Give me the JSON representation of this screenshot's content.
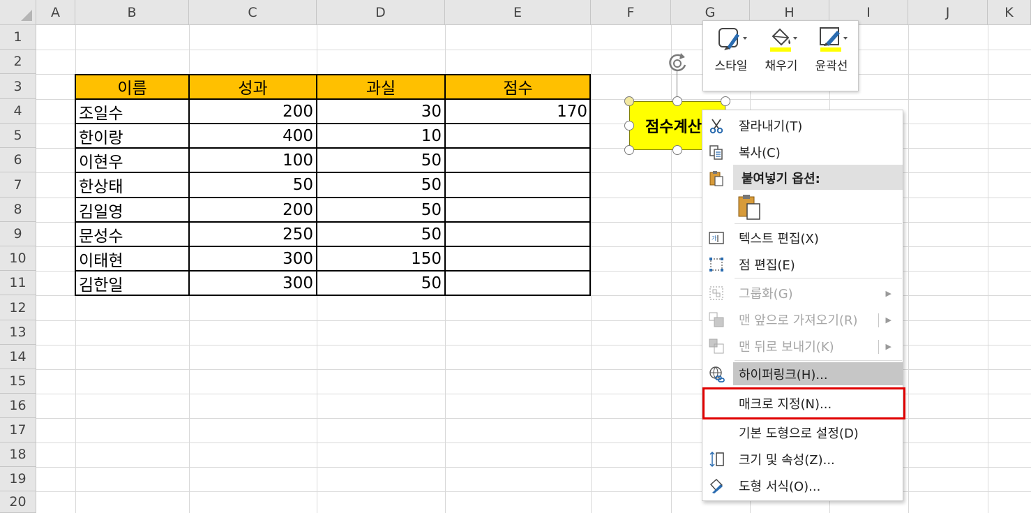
{
  "columns": [
    "A",
    "B",
    "C",
    "D",
    "E",
    "F",
    "G",
    "H",
    "I",
    "J",
    "K"
  ],
  "rows": [
    "1",
    "2",
    "3",
    "4",
    "5",
    "6",
    "7",
    "8",
    "9",
    "10",
    "11",
    "12",
    "13",
    "14",
    "15",
    "16",
    "17",
    "18",
    "19",
    "20"
  ],
  "table": {
    "headers": [
      "이름",
      "성과",
      "과실",
      "점수"
    ],
    "rows": [
      [
        "조일수",
        "200",
        "30",
        "170"
      ],
      [
        "한이랑",
        "400",
        "10",
        ""
      ],
      [
        "이현우",
        "100",
        "50",
        ""
      ],
      [
        "한상태",
        "50",
        "50",
        ""
      ],
      [
        "김일영",
        "200",
        "50",
        ""
      ],
      [
        "문성수",
        "250",
        "50",
        ""
      ],
      [
        "이태현",
        "300",
        "150",
        ""
      ],
      [
        "김한일",
        "300",
        "50",
        ""
      ]
    ]
  },
  "shape": {
    "text": "점수계산"
  },
  "mini_toolbar": {
    "style_label": "스타일",
    "fill_label": "채우기",
    "outline_label": "윤곽선"
  },
  "context_menu": {
    "cut": "잘라내기(T)",
    "copy": "복사(C)",
    "paste_options": "붙여넣기 옵션:",
    "edit_text": "텍스트 편집(X)",
    "edit_points": "점 편집(E)",
    "group": "그룹화(G)",
    "bring_to_front": "맨 앞으로 가져오기(R)",
    "send_to_back": "맨 뒤로 보내기(K)",
    "hyperlink": "하이퍼링크(H)...",
    "assign_macro": "매크로 지정(N)...",
    "set_default_shape": "기본 도형으로 설정(D)",
    "size_properties": "크기 및 속성(Z)...",
    "format_shape": "도형 서식(O)..."
  },
  "colors": {
    "header_fill": "#ffc000",
    "shape_fill": "#ffff00",
    "highlight_box": "#e00000",
    "tool_underline": "#ffff00",
    "icon_blue": "#2b6cb0"
  }
}
